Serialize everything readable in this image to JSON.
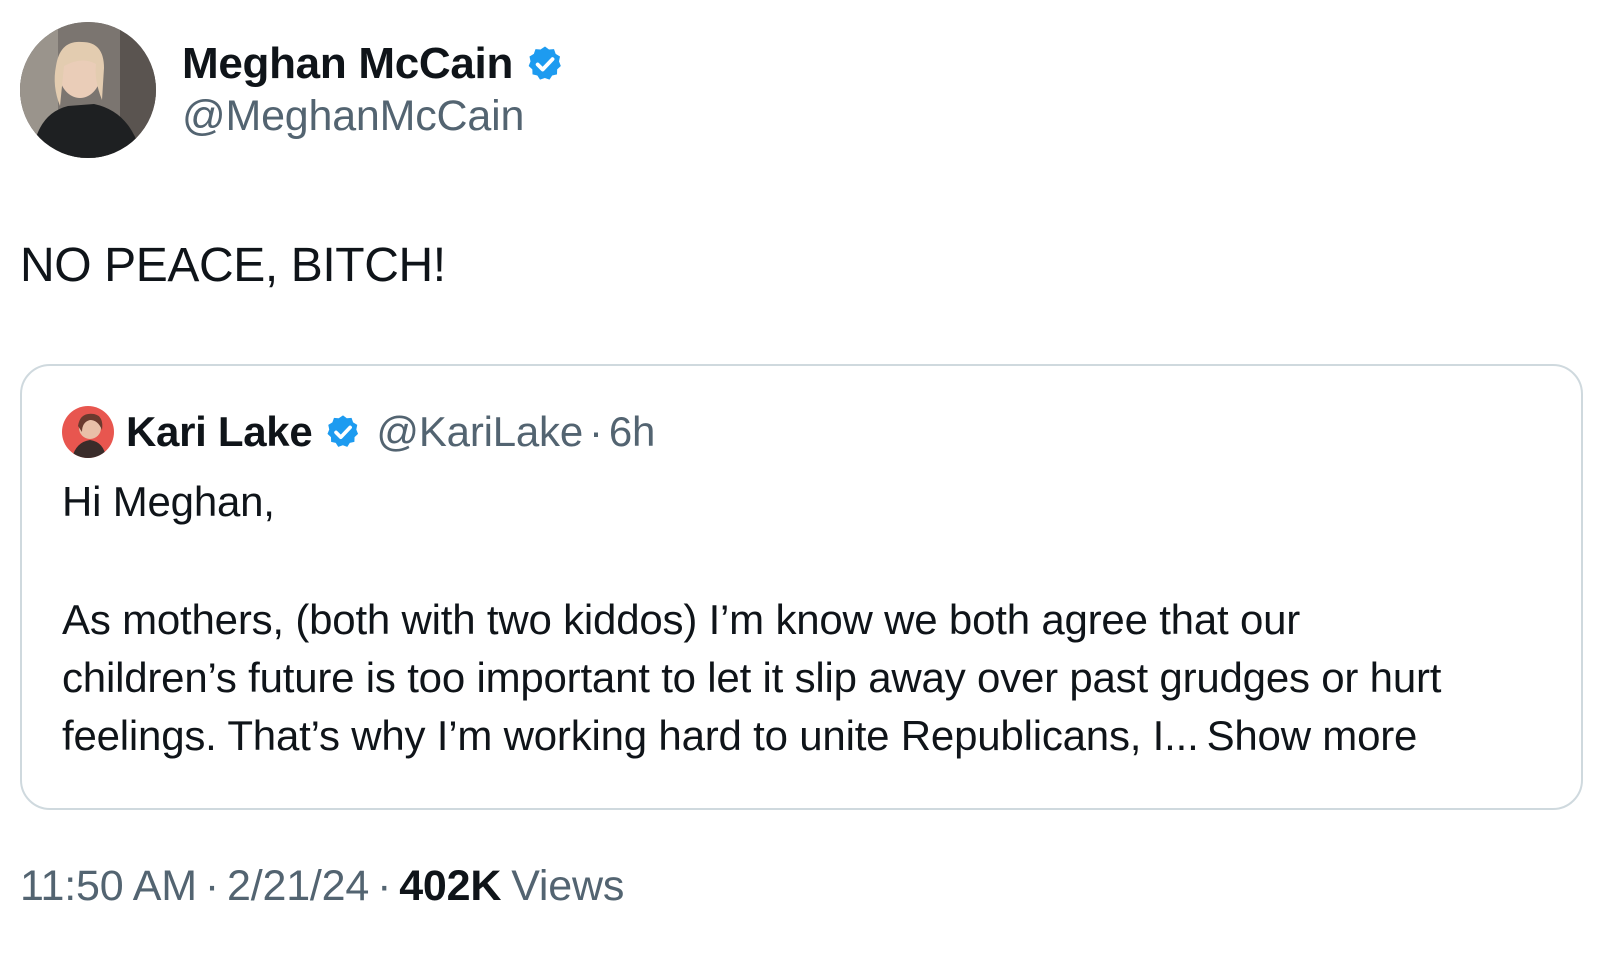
{
  "tweet": {
    "author": {
      "name": "Meghan McCain",
      "handle": "@MeghanMcCain",
      "verified_badge_icon": "verified-badge-icon"
    },
    "text": "NO PEACE, BITCH!",
    "quoted_tweet": {
      "author": {
        "name": "Kari Lake",
        "handle": "@KariLake",
        "verified_badge_icon": "verified-badge-icon"
      },
      "separator": "·",
      "time": "6h",
      "lines": [
        "Hi Meghan,",
        "As mothers, (both with two kiddos) I’m know we both agree that our",
        "children’s future is too important to let it slip away over past grudges or hurt",
        "feelings.  That’s why I’m working hard to unite Republicans, I..."
      ],
      "show_more_label": "Show more"
    },
    "meta": {
      "time": "11:50 AM",
      "separator": "·",
      "date": "2/21/24",
      "views_count": "402K",
      "views_label": "Views"
    }
  },
  "colors": {
    "text_primary": "#0f1419",
    "text_secondary": "#536471",
    "verified_blue": "#1d9bf0",
    "card_border": "#cfd9de"
  }
}
